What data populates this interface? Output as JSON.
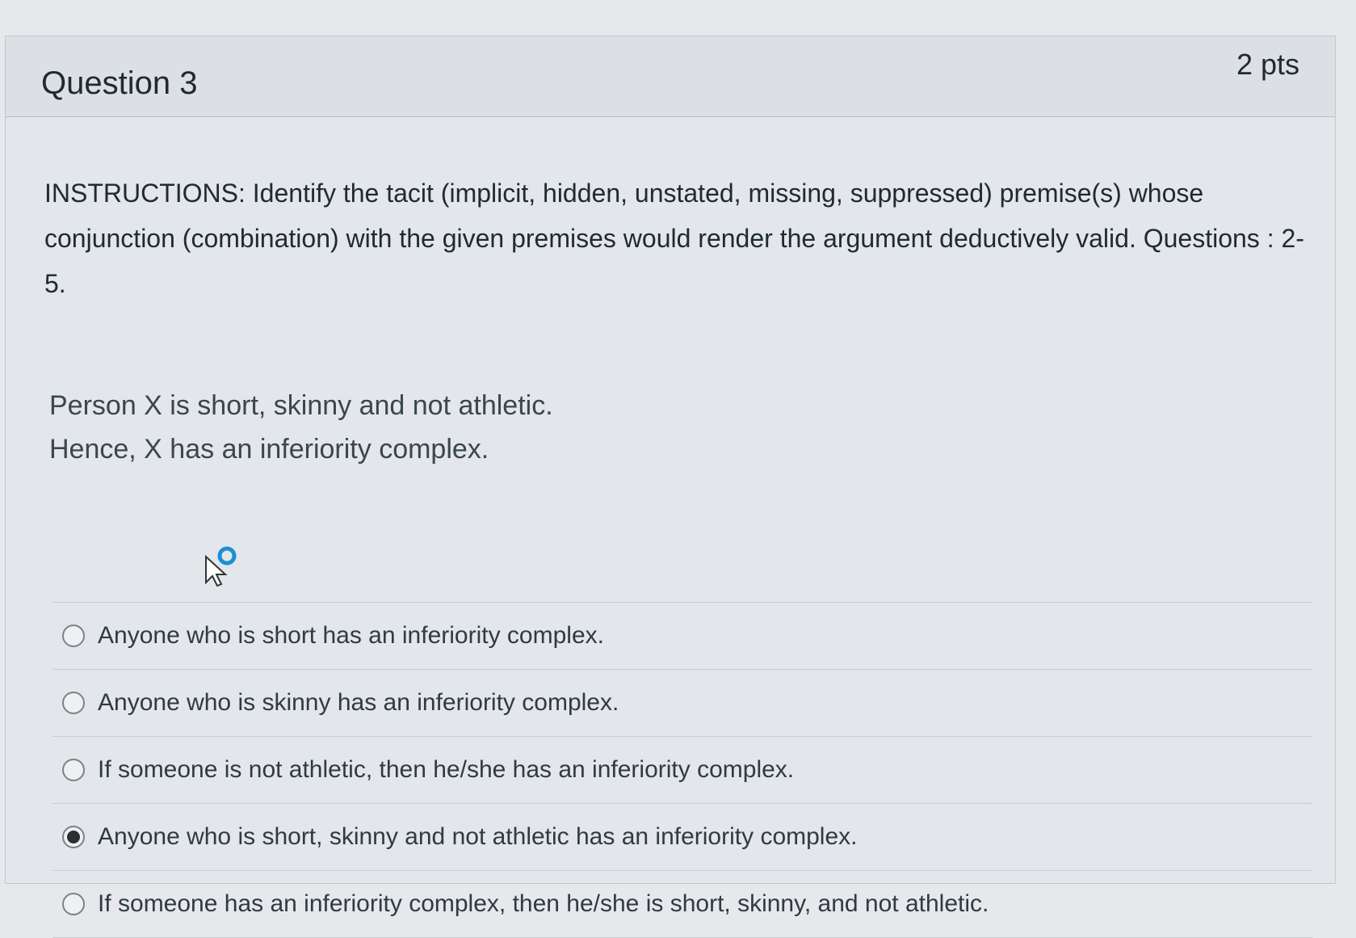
{
  "question": {
    "title": "Question 3",
    "points": "2 pts"
  },
  "instructions": "INSTRUCTIONS: Identify the tacit (implicit, hidden, unstated, missing, suppressed) premise(s) whose conjunction (combination) with the given premises would render the argument deductively valid. Questions : 2-5.",
  "argument": {
    "premise": "Person X is short, skinny and not athletic.",
    "conclusion": "Hence, X has an inferiority complex."
  },
  "answers": [
    {
      "label": "Anyone who is short has an inferiority complex.",
      "selected": false
    },
    {
      "label": "Anyone who is skinny has an inferiority complex.",
      "selected": false
    },
    {
      "label": "If someone is not athletic, then he/she has an inferiority complex.",
      "selected": false
    },
    {
      "label": "Anyone who is short, skinny and not athletic has an inferiority complex.",
      "selected": true
    },
    {
      "label": "If someone has an inferiority complex, then he/she is short, skinny, and not athletic.",
      "selected": false
    }
  ],
  "colors": {
    "background": "#e6e8ec",
    "header": "#dcdfe3",
    "cursor_ring": "#1a8fd6"
  },
  "icons": [
    "mouse-cursor-icon",
    "loading-ring-icon",
    "radio-icon"
  ]
}
